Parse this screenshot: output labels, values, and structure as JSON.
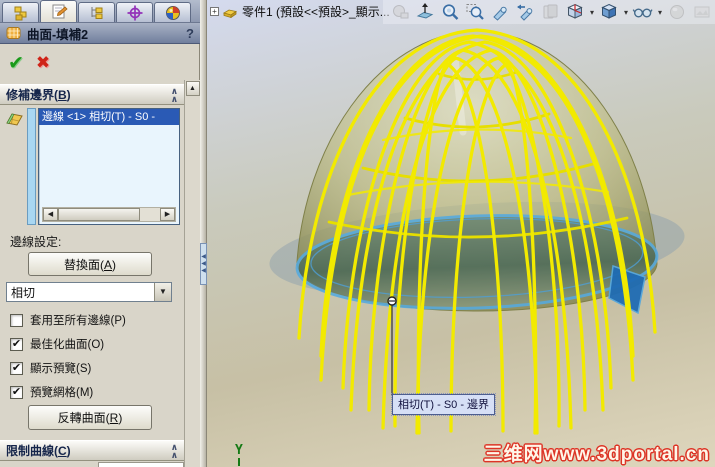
{
  "pm": {
    "tabs": [
      "featuremanager-tab",
      "propertymanager-tab",
      "configurationmanager-tab",
      "dimxpert-tab",
      "displaymanager-tab"
    ],
    "title": "曲面-填補2",
    "help": "?",
    "ok_glyph": "✔",
    "cancel_glyph": "✖",
    "patch_boundary": {
      "pre": "修補邊界(",
      "mn": "B",
      "post": ")"
    },
    "boundary_item": "邊線 <1> 相切(T) - S0 -",
    "edge_settings_label": "邊線設定:",
    "alternate_face": {
      "pre": "替換面(",
      "mn": "A",
      "post": ")"
    },
    "tangency_value": "相切",
    "checkboxes": [
      {
        "label": "套用至所有邊線(P)",
        "checked": false
      },
      {
        "label": "最佳化曲面(O)",
        "checked": true
      },
      {
        "label": "顯示預覽(S)",
        "checked": true
      },
      {
        "label": "預覽網格(M)",
        "checked": true
      }
    ],
    "reverse_surface": {
      "pre": "反轉曲面(",
      "mn": "R",
      "post": ")"
    },
    "constraint_curves": {
      "pre": "限制曲線(",
      "mn": "C",
      "post": ")"
    }
  },
  "vp": {
    "tree_item": "零件1 (預設<<預設>_顯示...",
    "callout": "相切(T) - S0 - 邊界",
    "y_label": "Y",
    "watermark": "三维网www.3dportal.cn",
    "toolbar_icons": [
      "measure-icon",
      "view-plane-icon",
      "zoom-fit-icon",
      "zoom-area-icon",
      "rotate-view-icon",
      "previous-view-icon",
      "section-view-icon",
      "view-orientation-icon",
      "display-style-icon",
      "hide-show-items-icon",
      "edit-appearance-icon",
      "apply-scene-icon"
    ]
  },
  "colors": {
    "selection_blue": "#2a5ab5",
    "edge_highlight_blue": "#55aadf",
    "curve_yellow": "#f2ea00",
    "dome_olive": "#9a9a5e",
    "inner_teal": "#42604f",
    "constraint_patch_blue": "#1f6cb4",
    "callout_bg": "#d6dff6",
    "watermark_red": "#dd3426",
    "triad_green": "#157a15",
    "viewport_top": "#d4daee",
    "viewport_bottom": "#ded6bd"
  }
}
